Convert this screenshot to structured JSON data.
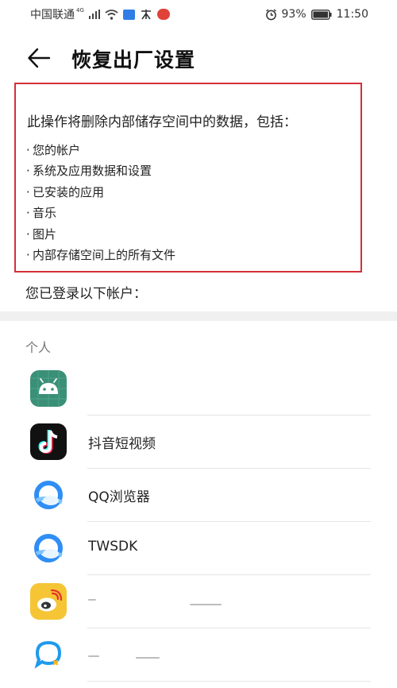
{
  "status_bar": {
    "carrier": "中国联通",
    "network": "4G",
    "battery": "93%",
    "time": "11:50"
  },
  "header": {
    "title": "恢复出厂设置"
  },
  "warning": {
    "intro": "此操作将删除内部储存空间中的数据，包括：",
    "items": [
      "您的帐户",
      "系统及应用数据和设置",
      "已安装的应用",
      "音乐",
      "图片",
      "内部存储空间上的所有文件"
    ]
  },
  "accounts": {
    "label": "您已登录以下帐户：",
    "section_header": "个人",
    "items": [
      {
        "label": "",
        "icon": "android-icon",
        "color": "#3a8f77"
      },
      {
        "label": "抖音短视频",
        "icon": "douyin-icon",
        "color": "#111111"
      },
      {
        "label": "QQ浏览器",
        "icon": "qq-browser-icon",
        "color": "#2f8ef5"
      },
      {
        "label": "TWSDK",
        "icon": "twsdk-icon",
        "color": "#2f8ef5"
      },
      {
        "label": "",
        "icon": "weibo-icon",
        "color": "#f5c535"
      },
      {
        "label": "",
        "icon": "chat-icon",
        "color": "#1f9aee"
      }
    ]
  },
  "colors": {
    "highlight_border": "#d32f3a",
    "divider_band": "#f0f0f0"
  }
}
